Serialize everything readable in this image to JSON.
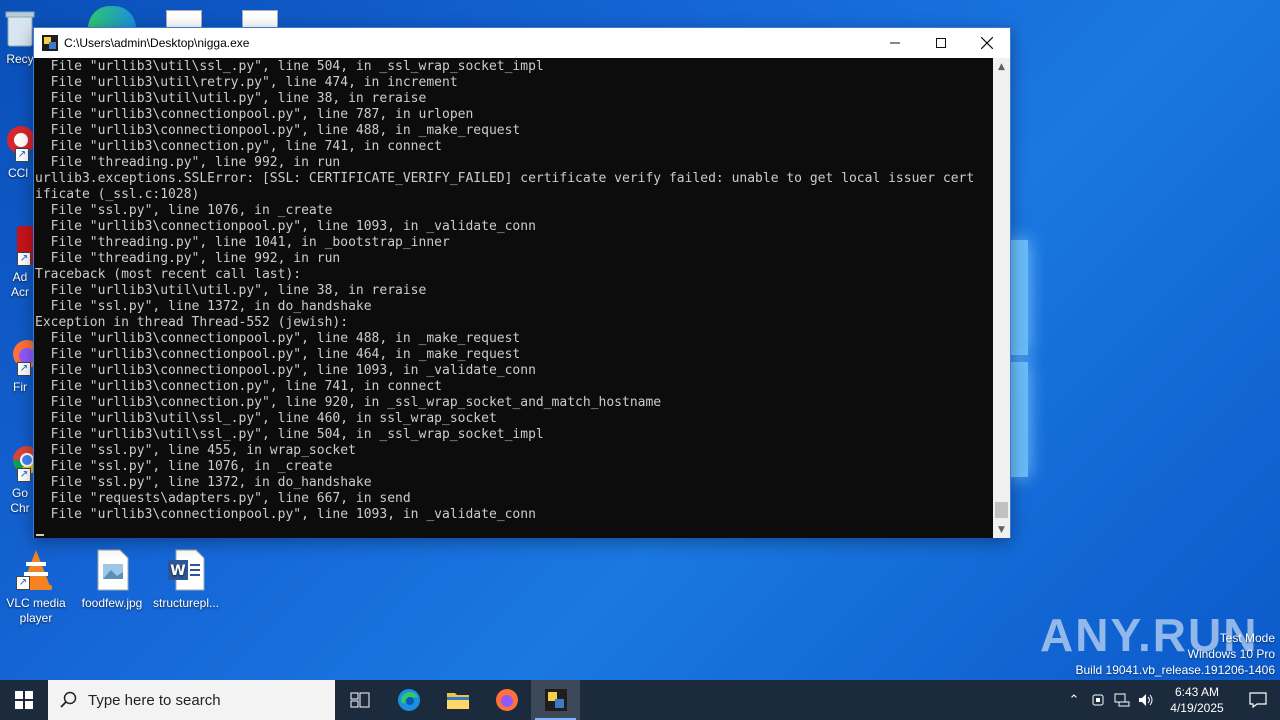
{
  "desktop": {
    "icons": [
      {
        "label": "Recy"
      },
      {
        "label": "CCl"
      },
      {
        "label": "Ad\nAcr"
      },
      {
        "label": "Fir"
      },
      {
        "label": "Go\nChr"
      },
      {
        "label": "VLC media\nplayer"
      },
      {
        "label": "foodfew.jpg"
      },
      {
        "label": "structurepl..."
      }
    ]
  },
  "console": {
    "title": "C:\\Users\\admin\\Desktop\\nigga.exe",
    "lines": [
      "  File \"urllib3\\util\\ssl_.py\", line 504, in _ssl_wrap_socket_impl",
      "  File \"urllib3\\util\\retry.py\", line 474, in increment",
      "  File \"urllib3\\util\\util.py\", line 38, in reraise",
      "  File \"urllib3\\connectionpool.py\", line 787, in urlopen",
      "  File \"urllib3\\connectionpool.py\", line 488, in _make_request",
      "  File \"urllib3\\connection.py\", line 741, in connect",
      "  File \"threading.py\", line 992, in run",
      "urllib3.exceptions.SSLError: [SSL: CERTIFICATE_VERIFY_FAILED] certificate verify failed: unable to get local issuer cert",
      "ificate (_ssl.c:1028)",
      "  File \"ssl.py\", line 1076, in _create",
      "  File \"urllib3\\connectionpool.py\", line 1093, in _validate_conn",
      "  File \"threading.py\", line 1041, in _bootstrap_inner",
      "  File \"threading.py\", line 992, in run",
      "Traceback (most recent call last):",
      "  File \"urllib3\\util\\util.py\", line 38, in reraise",
      "  File \"ssl.py\", line 1372, in do_handshake",
      "Exception in thread Thread-552 (jewish):",
      "  File \"urllib3\\connectionpool.py\", line 488, in _make_request",
      "  File \"urllib3\\connectionpool.py\", line 464, in _make_request",
      "  File \"urllib3\\connectionpool.py\", line 1093, in _validate_conn",
      "  File \"urllib3\\connection.py\", line 741, in connect",
      "  File \"urllib3\\connection.py\", line 920, in _ssl_wrap_socket_and_match_hostname",
      "  File \"urllib3\\util\\ssl_.py\", line 460, in ssl_wrap_socket",
      "  File \"urllib3\\util\\ssl_.py\", line 504, in _ssl_wrap_socket_impl",
      "  File \"ssl.py\", line 455, in wrap_socket",
      "  File \"ssl.py\", line 1076, in _create",
      "  File \"ssl.py\", line 1372, in do_handshake",
      "  File \"requests\\adapters.py\", line 667, in send",
      "  File \"urllib3\\connectionpool.py\", line 1093, in _validate_conn"
    ]
  },
  "watermark": {
    "logo": "ANY.RUN",
    "line1": "Test Mode",
    "line2": "Windows 10 Pro",
    "line3": "Build 19041.vb_release.191206-1406"
  },
  "taskbar": {
    "search_placeholder": "Type here to search",
    "time": "6:43 AM",
    "date": "4/19/2025"
  },
  "colors": {
    "console_bg": "#0c0c0c",
    "console_fg": "#cccccc",
    "taskbar_bg": "#1c2a3d"
  }
}
